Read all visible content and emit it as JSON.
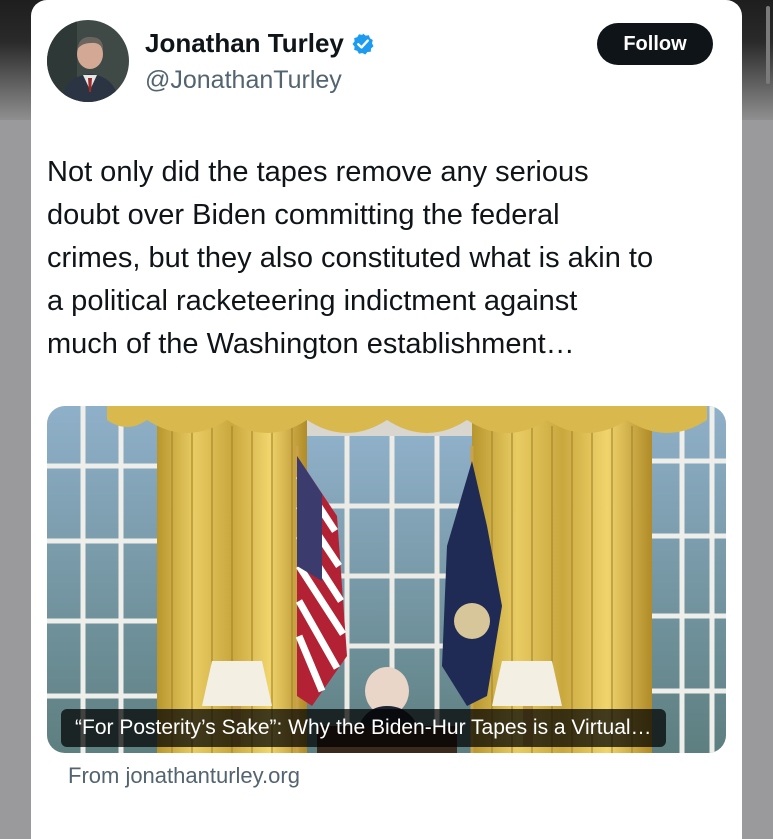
{
  "author": {
    "name": "Jonathan Turley",
    "handle": "@JonathanTurley",
    "verified_icon": "verified-badge-icon",
    "verified_color": "#1d9bf0"
  },
  "follow_button": {
    "label": "Follow"
  },
  "tweet": {
    "lines": [
      "Not only did the tapes remove any serious",
      "doubt over Biden committing the federal",
      "crimes, but they also constituted what is akin to",
      "a political racketeering indictment against",
      "much of the Washington establishment…"
    ]
  },
  "link_card": {
    "caption": "“For Posterity’s Sake”: Why the Biden-Hur Tapes is a Virtual…",
    "source": "From jonathanturley.org"
  },
  "colors": {
    "text_primary": "#0f1419",
    "text_secondary": "#536471",
    "button_bg": "#0f1419"
  }
}
